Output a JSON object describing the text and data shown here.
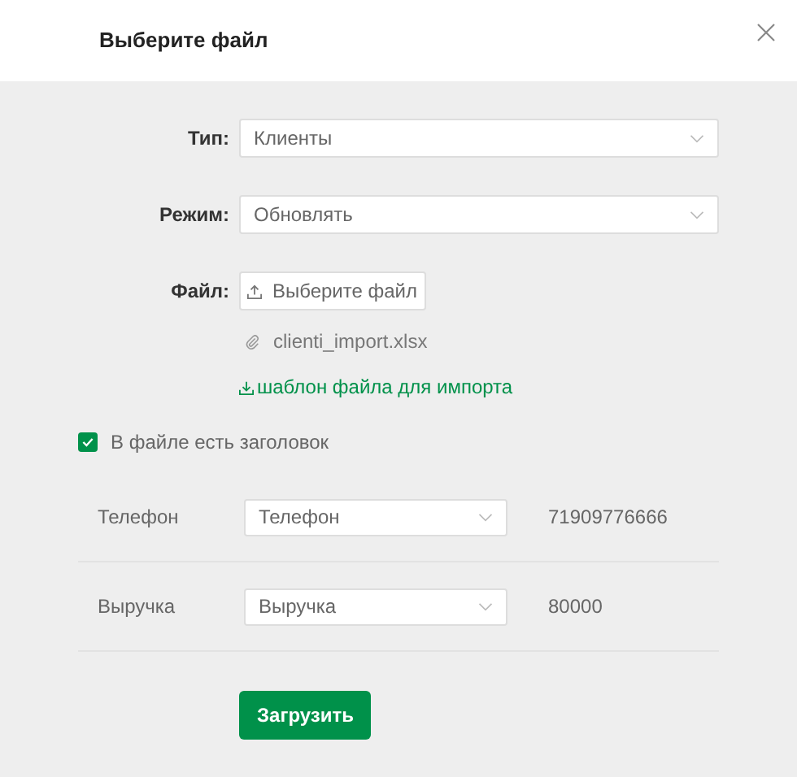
{
  "dialog": {
    "title": "Выберите файл"
  },
  "form": [
    {
      "label": "Тип:",
      "kind": "select",
      "value": "Клиенты"
    },
    {
      "label": "Режим:",
      "kind": "select",
      "value": "Обновлять"
    },
    {
      "label": "Файл:",
      "kind": "file",
      "button": "Выберите файл",
      "file_name": "clienti_import.xlsx",
      "template_link": "шаблон файла для импорта"
    }
  ],
  "header_checkbox": {
    "label": "В файле есть заголовок",
    "checked": true
  },
  "mapping": [
    {
      "column": "Телефон",
      "field": "Телефон",
      "sample": "71909776666"
    },
    {
      "column": "Выручка",
      "field": "Выручка",
      "sample": "80000"
    }
  ],
  "submit": "Загрузить"
}
